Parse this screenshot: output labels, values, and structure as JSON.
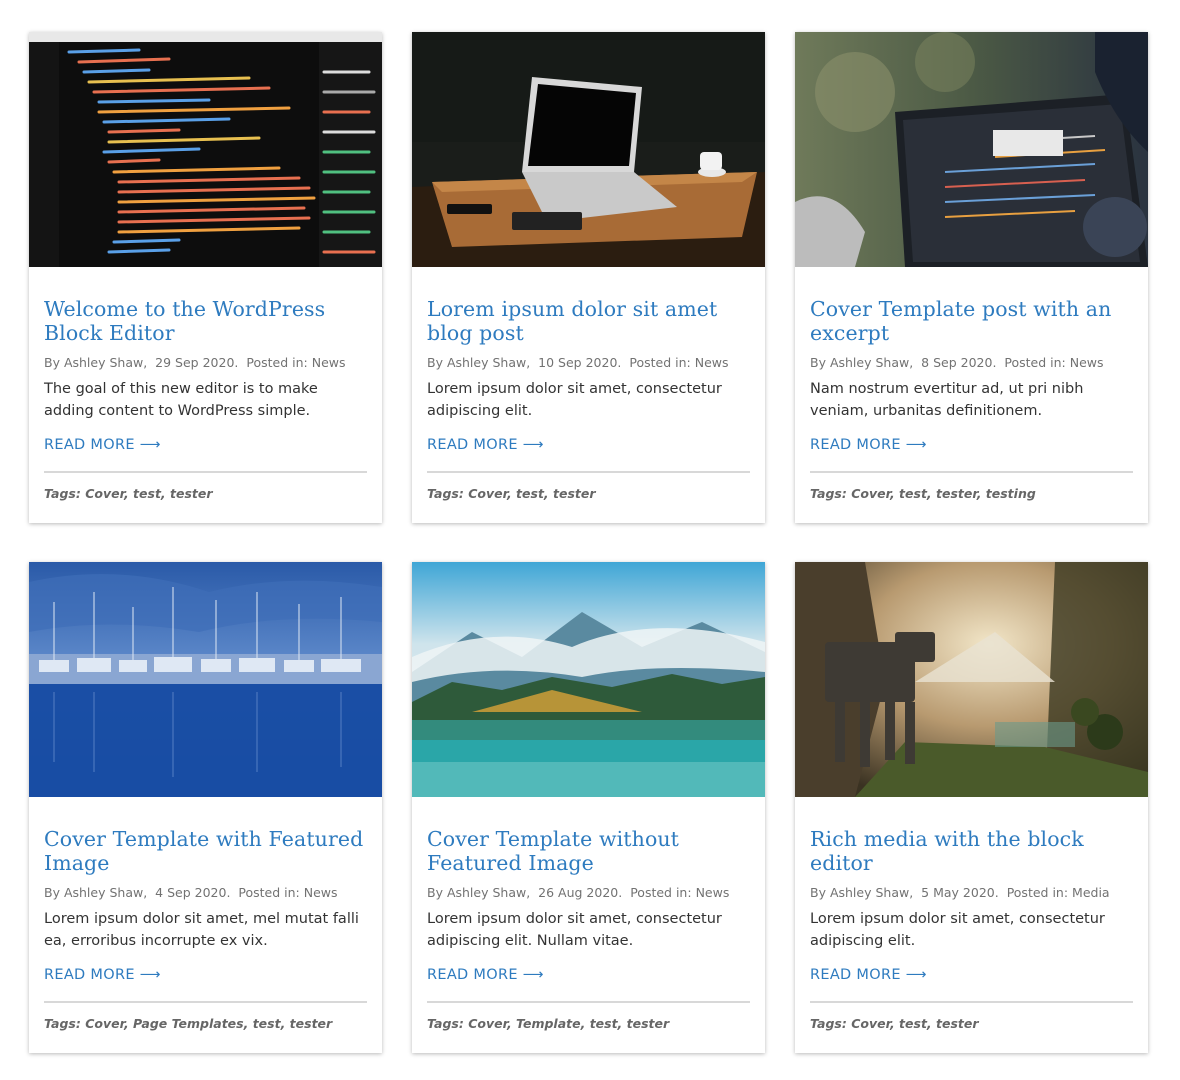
{
  "posts": [
    {
      "title": "Welcome to the WordPress Block Editor",
      "author": "By Ashley Shaw,",
      "date": "29 Sep 2020.",
      "posted_in_label": "Posted in:",
      "category": "News",
      "excerpt": "The goal of this new editor is to make adding content to WordPress simple.",
      "read_more": "READ MORE",
      "tags_label": "Tags:",
      "tags": "Cover, test, tester",
      "image": "code-editor-screen"
    },
    {
      "title": "Lorem ipsum dolor sit amet blog post",
      "author": "By Ashley Shaw,",
      "date": "10 Sep 2020.",
      "posted_in_label": "Posted in:",
      "category": "News",
      "excerpt": "Lorem ipsum dolor sit amet, consectetur adipiscing elit.",
      "read_more": "READ MORE",
      "tags_label": "Tags:",
      "tags": "Cover, test, tester",
      "image": "laptop-on-wooden-table"
    },
    {
      "title": "Cover Template post with an excerpt",
      "author": "By Ashley Shaw,",
      "date": "8 Sep 2020.",
      "posted_in_label": "Posted in:",
      "category": "News",
      "excerpt": "Nam nostrum evertitur ad, ut pri nibh veniam, urbanitas definitionem.",
      "read_more": "READ MORE",
      "tags_label": "Tags:",
      "tags": "Cover, test, tester, testing",
      "image": "person-using-laptop"
    },
    {
      "title": "Cover Template with Featured Image",
      "author": "By Ashley Shaw,",
      "date": "4 Sep 2020.",
      "posted_in_label": "Posted in:",
      "category": "News",
      "excerpt": "Lorem ipsum dolor sit amet, mel mutat falli ea, erroribus incorrupte ex vix.",
      "read_more": "READ MORE",
      "tags_label": "Tags:",
      "tags": "Cover, Page Templates, test, tester",
      "image": "marina-boats-blue"
    },
    {
      "title": "Cover Template without Featured Image",
      "author": "By Ashley Shaw,",
      "date": "26 Aug 2020.",
      "posted_in_label": "Posted in:",
      "category": "News",
      "excerpt": "Lorem ipsum dolor sit amet, consectetur adipiscing elit. Nullam vitae.",
      "read_more": "READ MORE",
      "tags_label": "Tags:",
      "tags": "Cover, Template, test, tester",
      "image": "mountain-lake-forest"
    },
    {
      "title": "Rich media with the block editor",
      "author": "By Ashley Shaw,",
      "date": "5 May 2020.",
      "posted_in_label": "Posted in:",
      "category": "Media",
      "excerpt": "Lorem ipsum dolor sit amet, consectetur adipiscing elit.",
      "read_more": "READ MORE",
      "tags_label": "Tags:",
      "tags": "Cover, test, tester",
      "image": "walker-in-valley-painting"
    }
  ],
  "colors": {
    "link": "#2e7bbf",
    "meta": "#727272",
    "text": "#333333",
    "divider": "#d8d8d8"
  },
  "icons": {
    "read_more_arrow": "arrow-right-icon"
  }
}
